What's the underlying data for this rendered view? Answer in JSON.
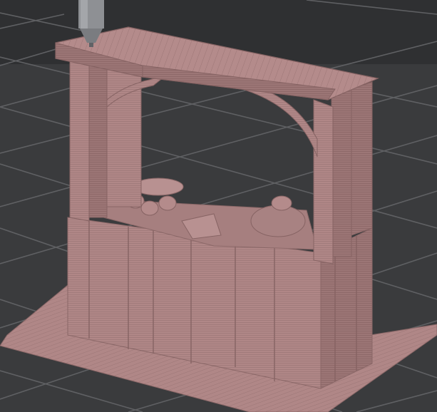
{
  "viewport": {
    "background": "#3a3b3d",
    "bed_color": "#3d3e40",
    "grid_color": "#5c5d60",
    "filament_color": "#b08787",
    "filament_shade": "#9a7474",
    "filament_dark": "#8a6767",
    "filament_light": "#c29a9a",
    "nozzle_color": "#8e9094"
  },
  "scene": {
    "object": "market-stall-model",
    "elements": [
      "brim",
      "counter",
      "left-post",
      "right-post",
      "roof",
      "produce",
      "nozzle"
    ]
  }
}
